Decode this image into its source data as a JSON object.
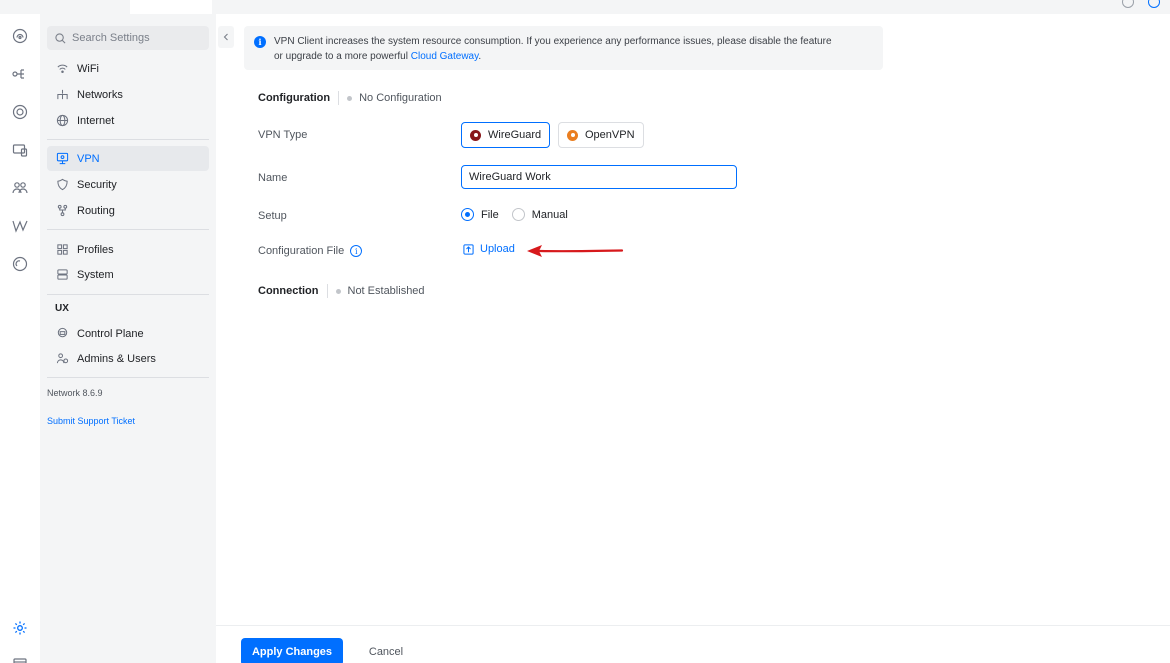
{
  "search": {
    "placeholder": "Search Settings"
  },
  "sidebar": {
    "items": [
      {
        "label": "WiFi"
      },
      {
        "label": "Networks"
      },
      {
        "label": "Internet"
      },
      {
        "label": "VPN"
      },
      {
        "label": "Security"
      },
      {
        "label": "Routing"
      },
      {
        "label": "Profiles"
      },
      {
        "label": "System"
      }
    ],
    "ux_section": "UX",
    "ux_items": [
      {
        "label": "Control Plane"
      },
      {
        "label": "Admins & Users"
      }
    ],
    "version": "Network 8.6.9",
    "support_link": "Submit Support Ticket"
  },
  "banner": {
    "text": "VPN Client increases the system resource consumption. If you experience any performance issues, please disable the feature",
    "text2": "or upgrade to a more powerful",
    "link": "Cloud Gateway",
    "end": "."
  },
  "configuration": {
    "title": "Configuration",
    "state": "No Configuration"
  },
  "fields": {
    "vpn_type_label": "VPN Type",
    "vpn_options": [
      "WireGuard",
      "OpenVPN"
    ],
    "selected_vpn": "WireGuard",
    "name_label": "Name",
    "name_value": "WireGuard Work",
    "setup_label": "Setup",
    "setup_options": [
      "File",
      "Manual"
    ],
    "selected_setup": "File",
    "config_file_label": "Configuration File",
    "upload_label": "Upload"
  },
  "connection": {
    "title": "Connection",
    "state": "Not Established"
  },
  "footer": {
    "apply_label": "Apply Changes",
    "cancel_label": "Cancel"
  },
  "colors": {
    "accent": "#006fff",
    "annotation_arrow": "#d7191c"
  }
}
